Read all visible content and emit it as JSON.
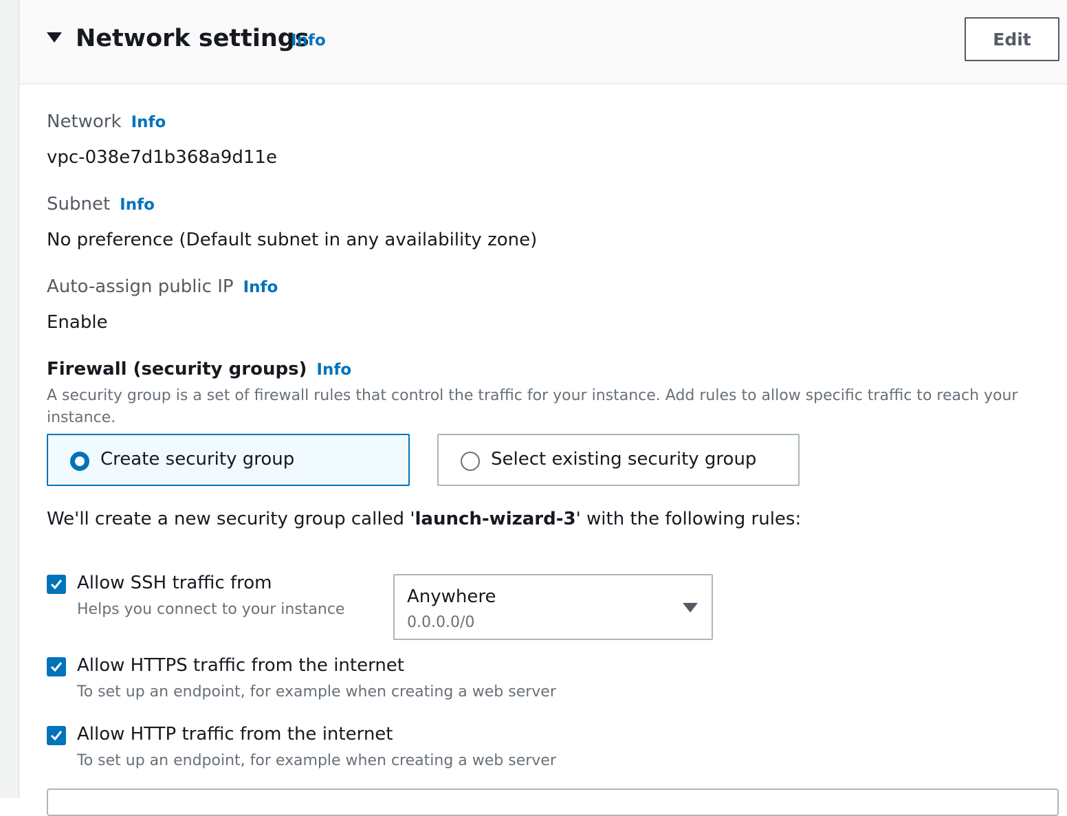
{
  "header": {
    "title": "Network settings",
    "info_label": "Info",
    "edit_label": "Edit"
  },
  "fields": {
    "network": {
      "label": "Network",
      "info": "Info",
      "value": "vpc-038e7d1b368a9d11e"
    },
    "subnet": {
      "label": "Subnet",
      "info": "Info",
      "value": "No preference (Default subnet in any availability zone)"
    },
    "public_ip": {
      "label": "Auto-assign public IP",
      "info": "Info",
      "value": "Enable"
    }
  },
  "firewall": {
    "label": "Firewall (security groups)",
    "info": "Info",
    "description": "A security group is a set of firewall rules that control the traffic for your instance. Add rules to allow specific traffic to reach your instance.",
    "options": [
      {
        "label": "Create security group",
        "selected": true
      },
      {
        "label": "Select existing security group",
        "selected": false
      }
    ],
    "sentence_prefix": "We'll create a new security group called '",
    "group_name": "launch-wizard-3",
    "sentence_suffix": "' with the following rules:"
  },
  "rules": [
    {
      "title": "Allow SSH traffic from",
      "description": "Helps you connect to your instance",
      "checked": true
    },
    {
      "title": "Allow HTTPS traffic from the internet",
      "description": "To set up an endpoint, for example when creating a web server",
      "checked": true
    },
    {
      "title": "Allow HTTP traffic from the internet",
      "description": "To set up an endpoint, for example when creating a web server",
      "checked": true
    }
  ],
  "ssh_source": {
    "value": "Anywhere",
    "detail": "0.0.0.0/0"
  },
  "colors": {
    "accent": "#0073bb",
    "text": "#16191f",
    "muted": "#687078",
    "border": "#aab7b8"
  },
  "icons": {
    "collapse": "caret-down-icon",
    "dropdown": "caret-down-icon",
    "checkbox": "checkmark-icon"
  }
}
